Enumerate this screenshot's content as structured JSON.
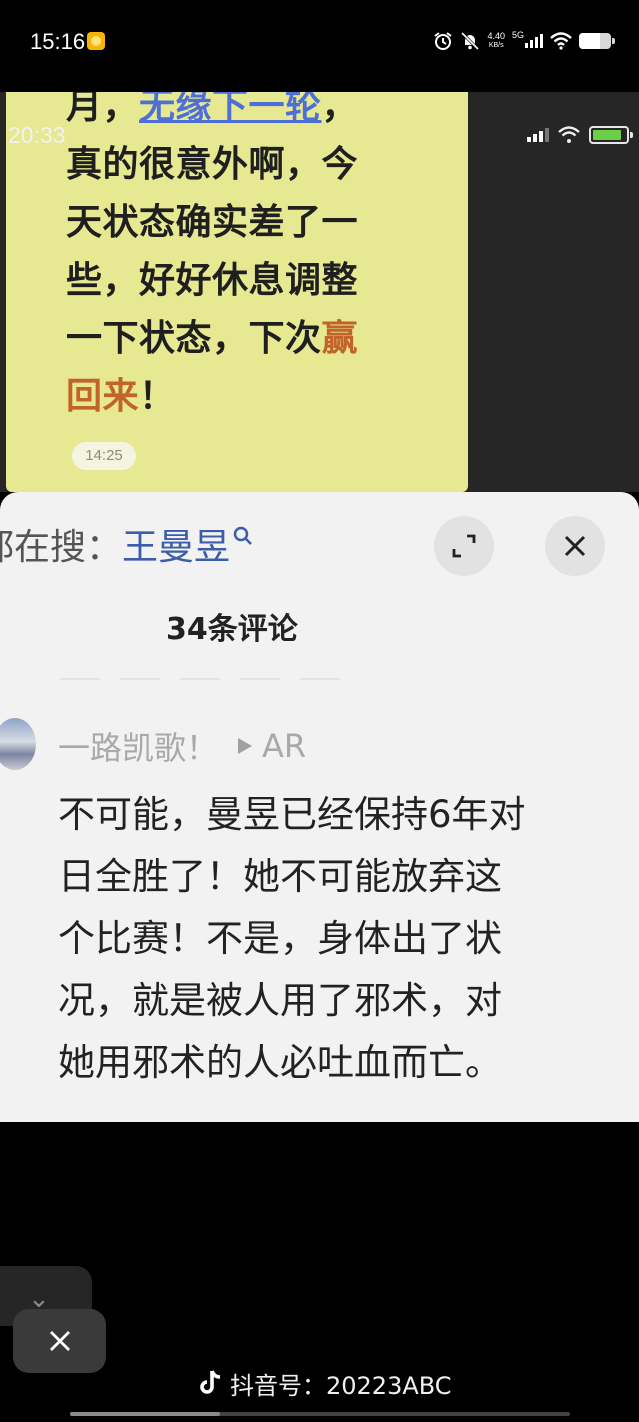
{
  "status_bar": {
    "time": "15:16",
    "net_speed_value": "4.40",
    "net_speed_unit": "KB/s",
    "network_type": "5G"
  },
  "inner_screenshot": {
    "time": "20:33",
    "message_lines": [
      {
        "pre": "月，",
        "hl": "无缘下一轮",
        "post": "，"
      },
      {
        "pre": "真的很意外啊，今",
        "hl": "",
        "post": ""
      },
      {
        "pre": "天状态确实差了一",
        "hl": "",
        "post": ""
      },
      {
        "pre": "些，好好休息调整",
        "hl": "",
        "post": ""
      },
      {
        "pre": "一下状态，下次",
        "hl": "赢",
        "post": ""
      },
      {
        "pre": "",
        "hl": "回来",
        "post": "！"
      }
    ],
    "message_time": "14:25",
    "comments_panel": {
      "search_prefix": "都在搜：",
      "search_term": "王曼昱",
      "comment_count": "34条评论",
      "comment": {
        "author": "一路凯歌！",
        "tag": "AR",
        "text_lines": [
          "不可能，曼昱已经保持6年对",
          "日全胜了！她不可能放弃这",
          "个比赛！不是，身体出了状",
          "况，就是被人用了邪术，对",
          "她用邪术的人必吐血而亡。"
        ]
      }
    }
  },
  "watermark": {
    "label": "抖音号：20223ABC"
  },
  "video_progress": 0.3,
  "icons": [
    "alarm-icon",
    "mute-bell-icon",
    "signal-icon",
    "wifi-icon",
    "battery-icon",
    "search-icon",
    "expand-icon",
    "close-icon",
    "play-icon",
    "tiktok-icon"
  ],
  "colors": {
    "bubble": "#e6e892",
    "highlight_blue": "#4d6fd6",
    "highlight_orange": "#c2632c",
    "panel_bg": "#f2f2f2",
    "search_term": "#3d5caa"
  }
}
